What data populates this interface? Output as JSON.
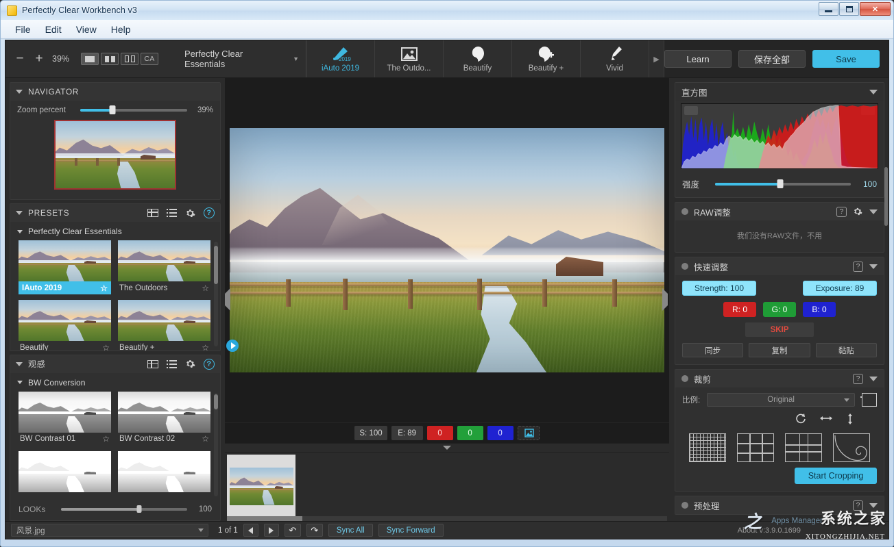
{
  "window": {
    "title": "Perfectly Clear Workbench v3",
    "app_icon": "app-icon",
    "minimize": "–",
    "maximize": "❐",
    "close": "✕"
  },
  "menu": {
    "items": [
      "File",
      "Edit",
      "View",
      "Help"
    ]
  },
  "toolbar": {
    "zoom_out": "−",
    "zoom_in": "+",
    "zoom_percent": "39%",
    "view_modes": [
      {
        "name": "single-view",
        "label": ""
      },
      {
        "name": "split-view",
        "label": ""
      },
      {
        "name": "side-by-side-view",
        "label": ""
      },
      {
        "name": "ca-view",
        "label": "CA"
      }
    ],
    "preset_name": "Perfectly Clear Essentials",
    "preset_caret": "▼",
    "tabs": [
      {
        "label": "iAuto 2019",
        "icon": "brush-2019-icon",
        "active": true
      },
      {
        "label": "The Outdo...",
        "icon": "landscape-icon",
        "active": false
      },
      {
        "label": "Beautify",
        "icon": "face-icon",
        "active": false
      },
      {
        "label": "Beautify +",
        "icon": "face-plus-icon",
        "active": false
      },
      {
        "label": "Vivid",
        "icon": "brush-icon",
        "active": false
      }
    ],
    "tabs_next": "▶",
    "learn_label": "Learn",
    "save_all_label": "保存全部",
    "save_label": "Save"
  },
  "navigator": {
    "title": "NAVIGATOR",
    "zoom_label": "Zoom percent",
    "zoom_value": "39%",
    "zoom_fill_percent": 30
  },
  "presets": {
    "title": "PRESETS",
    "group_label": "Perfectly Clear Essentials",
    "items": [
      {
        "label": "IAuto 2019",
        "selected": true,
        "star": "☆"
      },
      {
        "label": "The Outdoors",
        "selected": false,
        "star": "☆"
      },
      {
        "label": "Beautify",
        "selected": false,
        "star": "☆"
      },
      {
        "label": "Beautify +",
        "selected": false,
        "star": "☆"
      }
    ],
    "icons": {
      "grid": "grid-view-icon",
      "list": "list-view-icon",
      "gear": "settings-icon",
      "help": "help-icon"
    }
  },
  "looks": {
    "title": "观感",
    "group_label": "BW Conversion",
    "items": [
      {
        "label": "BW Contrast 01",
        "star": "☆"
      },
      {
        "label": "BW Contrast 02",
        "star": "☆"
      },
      {
        "label": "",
        "star": ""
      },
      {
        "label": "",
        "star": ""
      }
    ],
    "slider_label": "LOOKs",
    "slider_value": "100",
    "slider_fill_percent": 62
  },
  "canvas": {
    "readouts": [
      {
        "label": "S: 100",
        "kind": "grey"
      },
      {
        "label": "E: 89",
        "kind": "grey"
      },
      {
        "label": "0",
        "kind": "r"
      },
      {
        "label": "0",
        "kind": "g"
      },
      {
        "label": "0",
        "kind": "b"
      }
    ],
    "compare_icon": "compare-image-icon",
    "collapse_left_icon": "collapse-left-icon",
    "collapse_right_icon": "collapse-right-icon",
    "play_icon": "play-icon"
  },
  "histogram": {
    "title": "直方图",
    "collapse_icon": "chevron-down-icon",
    "strength_label": "强度",
    "strength_value": "100",
    "strength_fill_percent": 48
  },
  "raw_panel": {
    "title": "RAW调整",
    "note": "我们没有RAW文件，不用",
    "help": "?",
    "gear": "settings-icon",
    "caret": "▼"
  },
  "quick_panel": {
    "title": "快速调整",
    "help": "?",
    "caret": "▼",
    "strength_chip": "Strength: 100",
    "exposure_chip": "Exposure: 89",
    "r_chip": "R: 0",
    "g_chip": "G: 0",
    "b_chip": "B: 0",
    "skip_label": "SKIP",
    "sync_label": "同步",
    "copy_label": "复制",
    "paste_label": "黏贴"
  },
  "crop_panel": {
    "title": "裁剪",
    "help": "?",
    "caret": "▼",
    "ratio_label": "比例:",
    "ratio_value": "Original",
    "crop_tool_icon": "crop-tool-icon",
    "rotate_icon": "rotate-icon",
    "flip_h_icon": "flip-horizontal-icon",
    "flip_v_icon": "flip-vertical-icon",
    "overlays": [
      "fine-grid-overlay",
      "thirds-overlay",
      "golden-ratio-overlay",
      "golden-spiral-overlay"
    ],
    "start_cropping_label": "Start Cropping"
  },
  "preprocess_panel": {
    "title": "预处理",
    "help": "?",
    "caret": "▼"
  },
  "status_bar": {
    "file_name": "风景.jpg",
    "page_count": "1 of 1",
    "prev_icon": "previous-icon",
    "next_icon": "next-icon",
    "undo_icon": "↶",
    "redo_icon": "↷",
    "sync_all_label": "Sync All",
    "sync_forward_label": "Sync Forward",
    "about_text": "About v:3.9.0.1699"
  },
  "watermark": {
    "mark": "之",
    "chinese": "系统之家",
    "english": "XITONGZHIJIA.NET",
    "apps_manager": "Apps Manager"
  },
  "colors": {
    "accent": "#41bfe8",
    "panel_bg": "#303030",
    "app_bg": "#2b2b2b",
    "red": "#cf2222",
    "green": "#1f9c36",
    "blue": "#1f22d1",
    "navigator_frame": "#a03232"
  }
}
